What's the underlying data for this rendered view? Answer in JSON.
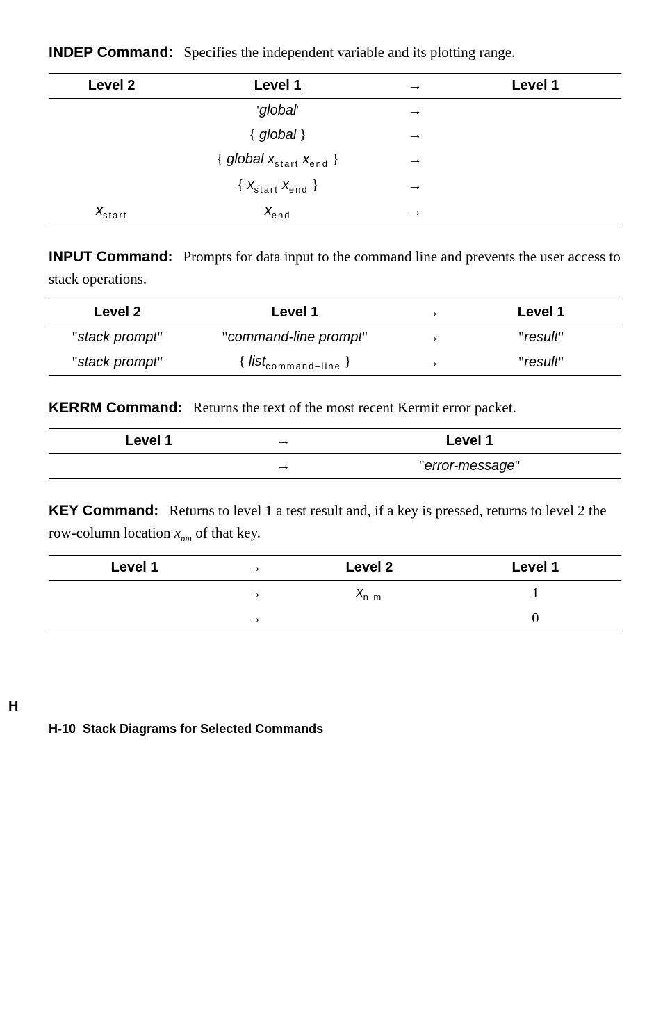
{
  "sideLetter": "H",
  "commands": {
    "indep": {
      "title": "INDEP Command:",
      "desc": "Specifies the independent variable and its plotting range.",
      "headers": {
        "l2": "Level 2",
        "l1": "Level 1",
        "arrow": "→",
        "r1": "Level 1"
      },
      "rows": [
        {
          "l2": "",
          "l1_html": "'<span class=\"ital\">global</span>'",
          "arrow": "→",
          "r1": ""
        },
        {
          "l2": "",
          "l1_html": "{ <span class=\"ital\">global</span> }",
          "arrow": "→",
          "r1": ""
        },
        {
          "l2": "",
          "l1_html": "{ <span class=\"ital\">global x</span><span class=\"sub\">start</span> <span class=\"ital\">x</span><span class=\"sub\">end</span> }",
          "arrow": "→",
          "r1": ""
        },
        {
          "l2": "",
          "l1_html": "{ <span class=\"ital\">x</span><span class=\"sub\">start</span> <span class=\"ital\">x</span><span class=\"sub\">end</span> }",
          "arrow": "→",
          "r1": ""
        },
        {
          "l2_html": "<span class=\"ital\">x</span><span class=\"sub\">start</span>",
          "l1_html": "<span class=\"ital\">x</span><span class=\"sub\">end</span>",
          "arrow": "→",
          "r1": ""
        }
      ]
    },
    "input": {
      "title": "INPUT Command:",
      "desc": "Prompts for data input to the command line and prevents the user access to stack operations.",
      "headers": {
        "l2": "Level 2",
        "l1": "Level 1",
        "arrow": "→",
        "r1": "Level 1"
      },
      "rows": [
        {
          "l2_html": "\"<span class=\"ital\">stack prompt</span>\"",
          "l1_html": "\"<span class=\"ital\">command-line prompt</span>\"",
          "arrow": "→",
          "r1_html": "\"<span class=\"ital\">result</span>\""
        },
        {
          "l2_html": "\"<span class=\"ital\">stack prompt</span>\"",
          "l1_html": "{ <span class=\"ital\">list</span><span class=\"sub\">command–line</span> }",
          "arrow": "→",
          "r1_html": "\"<span class=\"ital\">result</span>\""
        }
      ]
    },
    "kerrm": {
      "title": "KERRM Command:",
      "desc": "Returns the text of the most recent Kermit error packet.",
      "headers": {
        "l1": "Level 1",
        "arrow": "→",
        "r1": "Level 1"
      },
      "rows": [
        {
          "l1": "",
          "arrow": "→",
          "r1_html": "\"<span class=\"ital\">error-message</span>\""
        }
      ]
    },
    "key": {
      "title": "KEY Command:",
      "desc_html": "Returns to level 1 a test result and, if a key is pressed, returns to level 2 the row-column location <span style=\"font-style:italic\">x</span><span class=\"subm\">nm</span> of that key.",
      "headers": {
        "l1": "Level 1",
        "arrow": "→",
        "r2": "Level 2",
        "r1": "Level 1"
      },
      "rows": [
        {
          "l1": "",
          "arrow": "→",
          "r2_html": "<span class=\"ital\">x</span><span class=\"sub\">n m</span>",
          "r1": "1"
        },
        {
          "l1": "",
          "arrow": "→",
          "r2": "",
          "r1": "0"
        }
      ]
    }
  },
  "footer": "H-10  Stack Diagrams for Selected Commands"
}
